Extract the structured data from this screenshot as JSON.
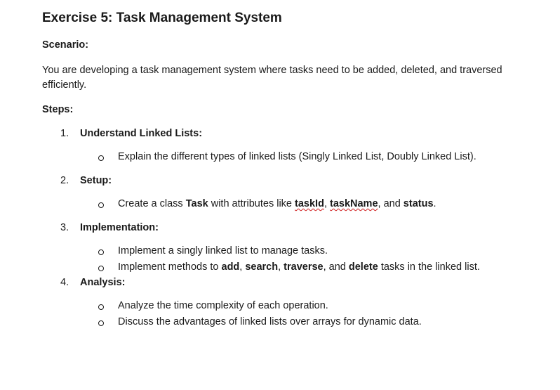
{
  "title": "Exercise 5: Task Management System",
  "scenario_label": "Scenario:",
  "scenario_text_line1": "You are developing a task management system where tasks need to be added, deleted, and traversed",
  "scenario_text_line2": "efficiently.",
  "steps_label": "Steps:",
  "steps": [
    {
      "num": "1.",
      "title": "Understand Linked Lists:",
      "bullets": [
        {
          "parts": [
            {
              "t": "Explain the different types of linked lists (Singly Linked List, Doubly Linked List)."
            }
          ]
        }
      ]
    },
    {
      "num": "2.",
      "title": "Setup:",
      "bullets": [
        {
          "parts": [
            {
              "t": "Create a class "
            },
            {
              "t": "Task",
              "b": true
            },
            {
              "t": " with attributes like "
            },
            {
              "t": "taskId",
              "b": true,
              "sq": true
            },
            {
              "t": ", "
            },
            {
              "t": "taskName",
              "b": true,
              "sq": true
            },
            {
              "t": ", and "
            },
            {
              "t": "status",
              "b": true
            },
            {
              "t": "."
            }
          ]
        }
      ]
    },
    {
      "num": "3.",
      "title": "Implementation:",
      "bullets": [
        {
          "parts": [
            {
              "t": "Implement a singly linked list to manage tasks."
            }
          ]
        },
        {
          "parts": [
            {
              "t": "Implement methods to "
            },
            {
              "t": "add",
              "b": true
            },
            {
              "t": ", "
            },
            {
              "t": "search",
              "b": true
            },
            {
              "t": ", "
            },
            {
              "t": "traverse",
              "b": true
            },
            {
              "t": ", and "
            },
            {
              "t": "delete",
              "b": true
            },
            {
              "t": " tasks in the linked list."
            }
          ]
        }
      ]
    },
    {
      "num": "4.",
      "title": "Analysis:",
      "bullets": [
        {
          "parts": [
            {
              "t": "Analyze the time complexity of each operation."
            }
          ]
        },
        {
          "parts": [
            {
              "t": "Discuss the advantages of linked lists over arrays for dynamic data."
            }
          ]
        }
      ]
    }
  ],
  "colors": {
    "text": "#1a1a1a",
    "spellcheck": "#d02020"
  }
}
